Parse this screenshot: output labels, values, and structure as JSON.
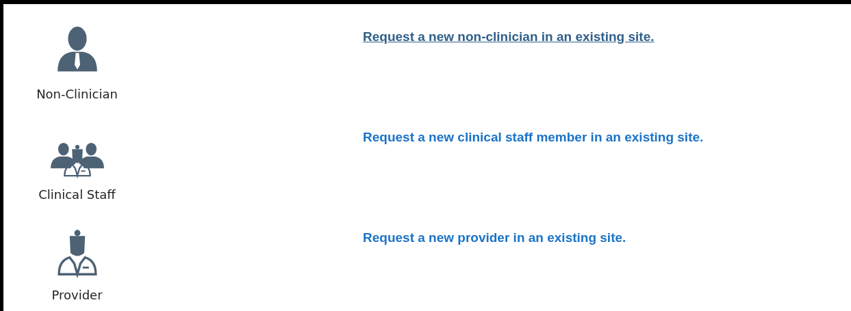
{
  "options": [
    {
      "kind": "non-clinician",
      "label": "Non-Clinician",
      "link": "Request a new non-clinician in an existing site.",
      "hovered": true
    },
    {
      "kind": "clinical-staff",
      "label": "Clinical Staff",
      "link": "Request a new clinical staff member in an existing site.",
      "hovered": false
    },
    {
      "kind": "provider",
      "label": "Provider",
      "link": "Request a new provider in an existing site.",
      "hovered": false
    }
  ]
}
